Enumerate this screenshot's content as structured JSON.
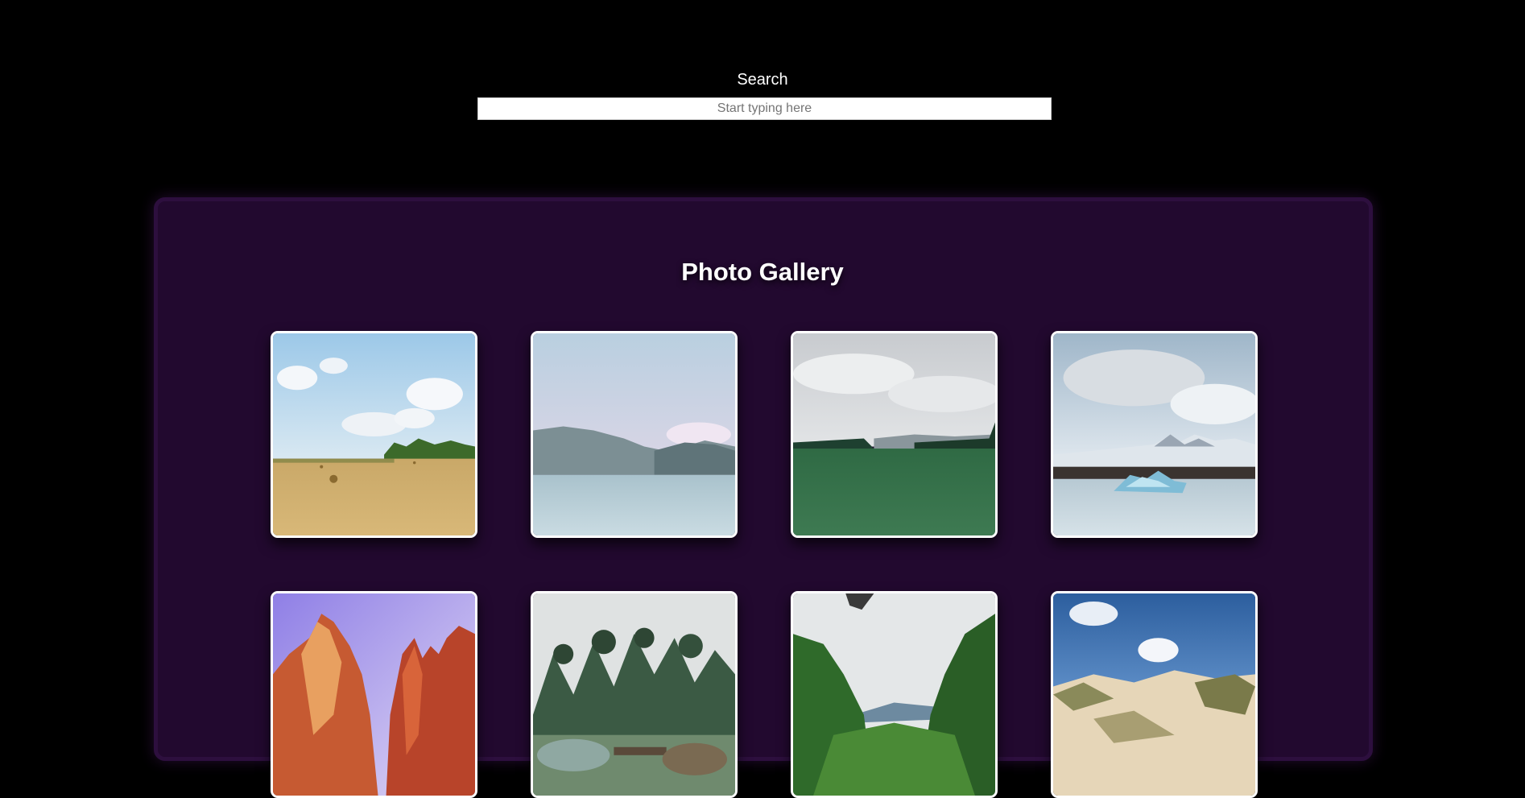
{
  "search": {
    "label": "Search",
    "placeholder": "Start typing here",
    "value": ""
  },
  "gallery": {
    "title": "Photo Gallery",
    "photos": [
      {
        "name": "photo-hay-field"
      },
      {
        "name": "photo-mountain-lake"
      },
      {
        "name": "photo-green-meadow"
      },
      {
        "name": "photo-glacier-lagoon"
      },
      {
        "name": "photo-red-canyon"
      },
      {
        "name": "photo-pine-garden"
      },
      {
        "name": "photo-forest-valley"
      },
      {
        "name": "photo-sand-dunes"
      }
    ]
  },
  "colors": {
    "background": "#000000",
    "panel": "#22092f",
    "panel_border": "#2d0f3e",
    "tile_border": "#ffffff"
  }
}
